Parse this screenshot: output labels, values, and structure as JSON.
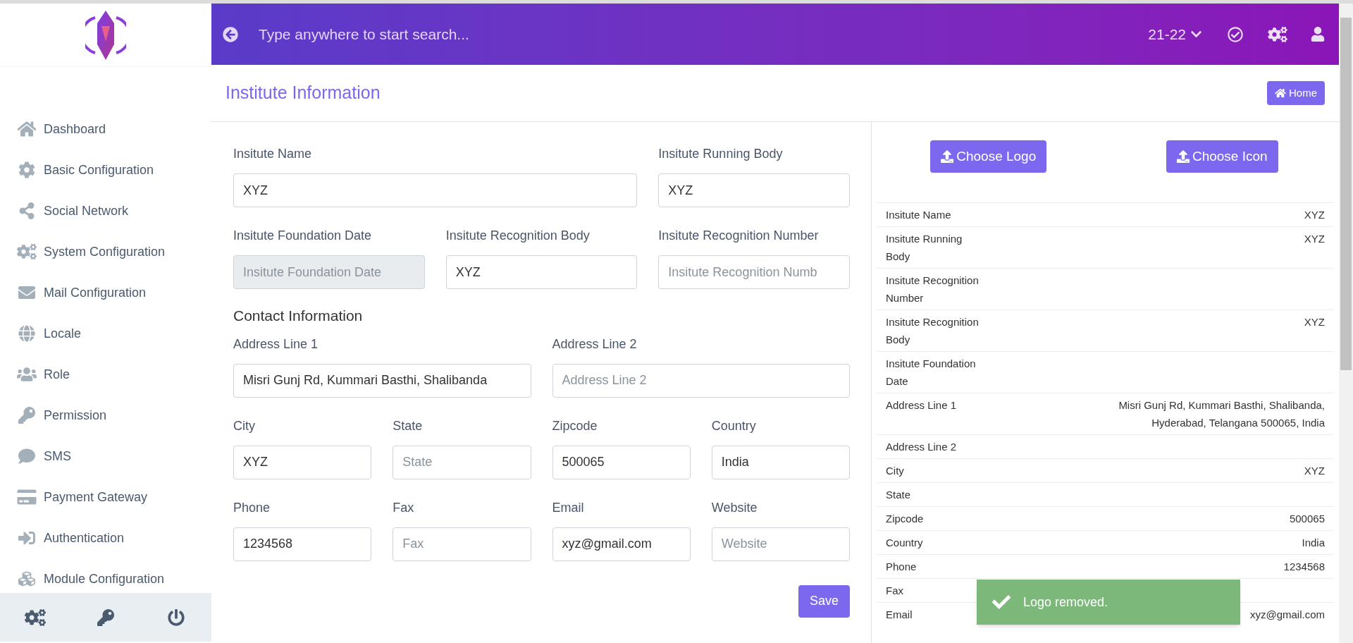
{
  "sidebar": {
    "items": [
      {
        "label": "Dashboard"
      },
      {
        "label": "Basic Configuration"
      },
      {
        "label": "Social Network"
      },
      {
        "label": "System Configuration"
      },
      {
        "label": "Mail Configuration"
      },
      {
        "label": "Locale"
      },
      {
        "label": "Role"
      },
      {
        "label": "Permission"
      },
      {
        "label": "SMS"
      },
      {
        "label": "Payment Gateway"
      },
      {
        "label": "Authentication"
      },
      {
        "label": "Module Configuration"
      }
    ]
  },
  "header": {
    "search_placeholder": "Type anywhere to start search...",
    "session": "21-22"
  },
  "page": {
    "title": "Institute Information",
    "home_button": "Home"
  },
  "form": {
    "rows": [
      {
        "kind": "wide_first",
        "fields": [
          {
            "label": "Insitute Name",
            "value": "XYZ",
            "disabled": false
          },
          {
            "label": "Insitute Running Body",
            "value": "XYZ",
            "disabled": false
          }
        ]
      },
      {
        "kind": "fields",
        "fields": [
          {
            "label": "Insitute Foundation Date",
            "placeholder": "Insitute Foundation Date",
            "disabled": true
          },
          {
            "label": "Insitute Recognition Body",
            "value": "XYZ",
            "disabled": false
          },
          {
            "label": "Insitute Recognition Number",
            "placeholder": "Insitute Recognition Numb",
            "disabled": false
          }
        ]
      },
      {
        "kind": "heading",
        "text": "Contact Information"
      },
      {
        "kind": "fields",
        "fields": [
          {
            "label": "Address Line 1",
            "value": "Misri Gunj Rd, Kummari Basthi, Shalibanda",
            "disabled": false
          },
          {
            "label": "Address Line 2",
            "placeholder": "Address Line 2",
            "disabled": false
          }
        ]
      },
      {
        "kind": "fields",
        "fields": [
          {
            "label": "City",
            "value": "XYZ",
            "disabled": false
          },
          {
            "label": "State",
            "placeholder": "State",
            "disabled": false
          },
          {
            "label": "Zipcode",
            "value": "500065",
            "disabled": false
          },
          {
            "label": "Country",
            "value": "India",
            "disabled": false
          }
        ]
      },
      {
        "kind": "fields",
        "fields": [
          {
            "label": "Phone",
            "value": "1234568",
            "disabled": false
          },
          {
            "label": "Fax",
            "placeholder": "Fax",
            "disabled": false
          },
          {
            "label": "Email",
            "value": "xyz@gmail.com",
            "disabled": false
          },
          {
            "label": "Website",
            "placeholder": "Website",
            "disabled": false
          }
        ]
      }
    ],
    "save_button": "Save"
  },
  "upload_buttons": [
    "Choose Logo",
    "Choose Icon"
  ],
  "summary": [
    {
      "label": "Insitute Name",
      "value": "XYZ"
    },
    {
      "label": "Insitute Running Body",
      "value": "XYZ"
    },
    {
      "label": "Insitute Recognition Number"
    },
    {
      "label": "Insitute Recognition Body",
      "value": "XYZ"
    },
    {
      "label": "Insitute Foundation Date"
    },
    {
      "label": "Address Line 1",
      "value": "Misri Gunj Rd, Kummari Basthi, Shalibanda, Hyderabad, Telangana 500065, India"
    },
    {
      "label": "Address Line 2"
    },
    {
      "label": "City",
      "value": "XYZ"
    },
    {
      "label": "State"
    },
    {
      "label": "Zipcode",
      "value": "500065"
    },
    {
      "label": "Country",
      "value": "India"
    },
    {
      "label": "Phone",
      "value": "1234568"
    },
    {
      "label": "Fax"
    },
    {
      "label": "Email",
      "value": "xyz@gmail.com"
    }
  ],
  "toast": {
    "message": "Logo removed."
  }
}
